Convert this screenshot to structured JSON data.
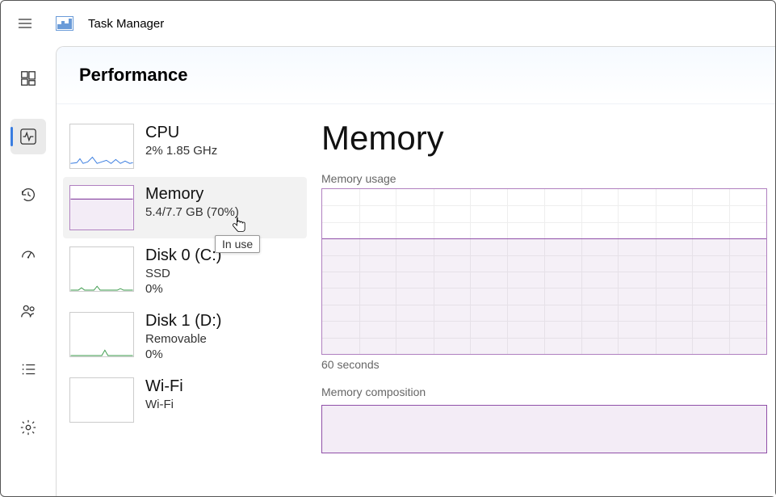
{
  "app": {
    "title": "Task Manager"
  },
  "nav": {
    "items": [
      {
        "id": "processes"
      },
      {
        "id": "performance"
      },
      {
        "id": "history"
      },
      {
        "id": "startup"
      },
      {
        "id": "users"
      },
      {
        "id": "details"
      },
      {
        "id": "settings"
      }
    ],
    "selected": 1
  },
  "page": {
    "title": "Performance"
  },
  "perf_list": {
    "items": [
      {
        "name": "CPU",
        "sub1": "2%  1.85 GHz",
        "sub2": ""
      },
      {
        "name": "Memory",
        "sub1": "5.4/7.7 GB (70%)",
        "sub2": ""
      },
      {
        "name": "Disk 0 (C:)",
        "sub1": "SSD",
        "sub2": "0%"
      },
      {
        "name": "Disk 1 (D:)",
        "sub1": "Removable",
        "sub2": "0%"
      },
      {
        "name": "Wi-Fi",
        "sub1": "Wi-Fi",
        "sub2": ""
      }
    ],
    "selected": 1,
    "tooltip": "In use"
  },
  "detail": {
    "title": "Memory",
    "usage_label": "Memory usage",
    "axis_label": "60 seconds",
    "composition_label": "Memory composition"
  },
  "colors": {
    "accent_memory": "#9050a8",
    "accent_cpu": "#3a7de0"
  },
  "chart_data": {
    "type": "area",
    "title": "Memory usage",
    "xlabel": "60 seconds",
    "ylabel": "",
    "ylim": [
      0,
      100
    ],
    "x": [
      0,
      60
    ],
    "series": [
      {
        "name": "In use %",
        "values": [
          70,
          70
        ]
      }
    ]
  }
}
